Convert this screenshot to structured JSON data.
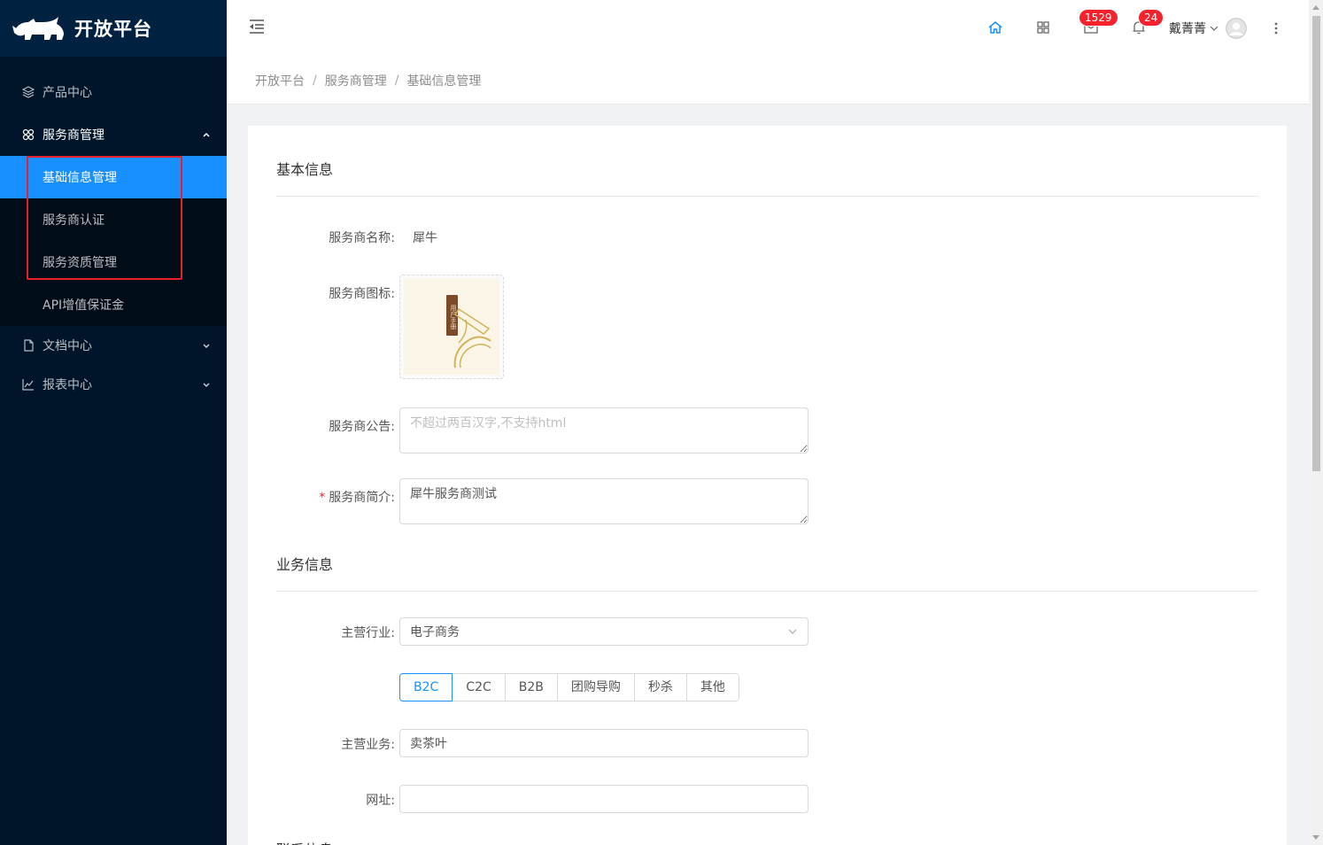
{
  "app": {
    "title": "开放平台"
  },
  "sidebar": {
    "items": [
      {
        "label": "产品中心",
        "icon": "layers-icon"
      },
      {
        "label": "服务商管理",
        "icon": "apps-icon",
        "expanded": true,
        "children": [
          {
            "label": "基础信息管理",
            "active": true
          },
          {
            "label": "服务商认证"
          },
          {
            "label": "服务资质管理"
          },
          {
            "label": "API增值保证金"
          }
        ]
      },
      {
        "label": "文档中心",
        "icon": "file-icon"
      },
      {
        "label": "报表中心",
        "icon": "line-chart-icon"
      }
    ]
  },
  "header": {
    "messages_count": "1529",
    "notifications_count": "24",
    "user_name": "戴菁菁"
  },
  "breadcrumb": [
    "开放平台",
    "服务商管理",
    "基础信息管理"
  ],
  "form": {
    "basic_section_title": "基本信息",
    "name_label": "服务商名称:",
    "name_value": "犀牛",
    "icon_label": "服务商图标:",
    "icon_caption": "用户手册",
    "notice_label": "服务商公告:",
    "notice_placeholder": "不超过两百汉字,不支持html",
    "notice_value": "",
    "intro_label": "服务商简介:",
    "intro_required_mark": "*",
    "intro_value": "犀牛服务商测试",
    "business_section_title": "业务信息",
    "industry_label": "主营行业:",
    "industry_value": "电子商务",
    "business_types": [
      "B2C",
      "C2C",
      "B2B",
      "团购导购",
      "秒杀",
      "其他"
    ],
    "business_type_selected": "B2C",
    "main_business_label": "主营业务:",
    "main_business_value": "卖茶叶",
    "website_label": "网址:",
    "website_value": "",
    "contact_section_title": "联系信息"
  },
  "colors": {
    "sidebar_bg": "#001529",
    "active": "#1890ff",
    "badge": "#f5222d",
    "highlight_box": "#e8202a"
  }
}
